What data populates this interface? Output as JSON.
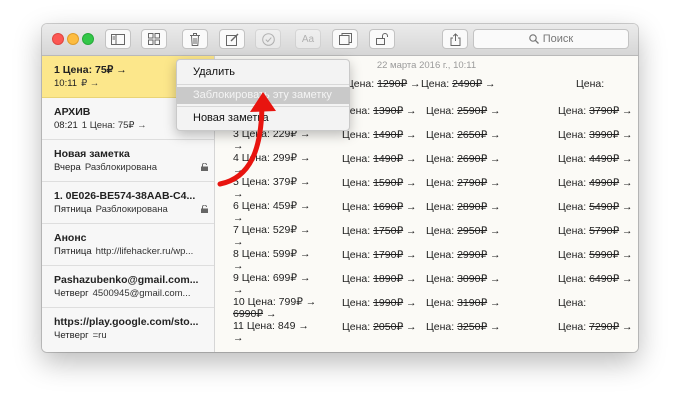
{
  "toolbar": {
    "buttons": [
      {
        "name": "sidebar-toggle-button",
        "icon": "sidebar-icon"
      },
      {
        "name": "attachments-browser-button",
        "icon": "grid-icon"
      },
      {
        "name": "delete-button",
        "icon": "trash-icon"
      },
      {
        "name": "new-note-button",
        "icon": "compose-icon"
      },
      {
        "name": "checklist-button",
        "icon": "checkmark-circle-icon"
      },
      {
        "name": "format-button",
        "icon": "text-format-icon"
      },
      {
        "name": "add-photo-button",
        "icon": "photo-icon"
      },
      {
        "name": "lock-button",
        "icon": "padlock-icon"
      },
      {
        "name": "share-button",
        "icon": "share-icon"
      }
    ],
    "format_label": "Aa",
    "search_placeholder": "Поиск"
  },
  "sidebar": {
    "notes": [
      {
        "title": "1 Цена: 75₽ →",
        "date": "10:11",
        "preview": "₽ →",
        "locked": false,
        "selected": true
      },
      {
        "title": "АРХИВ",
        "date": "08:21",
        "preview": "1 Цена: 75₽ →",
        "locked": false,
        "selected": false
      },
      {
        "title": "Новая заметка",
        "date": "Вчера",
        "preview": "Разблокирована",
        "locked": true,
        "selected": false
      },
      {
        "title": "1. 0E026-BE574-38AAB-C4...",
        "date": "Пятница",
        "preview": "Разблокирована",
        "locked": true,
        "selected": false
      },
      {
        "title": "Анонс",
        "date": "Пятница",
        "preview": "http://lifehacker.ru/wp...",
        "locked": false,
        "selected": false
      },
      {
        "title": "Pashazubenko@gmail.com...",
        "date": "Четверг",
        "preview": "4500945@gmail.com...",
        "locked": false,
        "selected": false
      },
      {
        "title": "https://play.google.com/sto...",
        "date": "Четверг",
        "preview": "=ru",
        "locked": false,
        "selected": false
      }
    ]
  },
  "content": {
    "date": "22 марта 2016 г., 10:11",
    "row0": {
      "c2": "Цена: ",
      "c2s": "1290₽",
      "c2a": " →",
      "c3": "Цена: ",
      "c3s": "2490₽",
      "c3a": " →",
      "c4": "Цена:"
    },
    "rows": [
      {
        "c1": "",
        "c1cont": "",
        "c2": "Цена: ",
        "c2s": "1390₽",
        "c3": "Цена: ",
        "c3s": "2590₽",
        "c4": "Цена: ",
        "c4s": "3790₽"
      },
      {
        "c1": "3 Цена: 229₽ →",
        "c2": "Цена: ",
        "c2s": "1490₽",
        "c3": "Цена: ",
        "c3s": "2650₽",
        "c4": "Цена: ",
        "c4s": "3990₽"
      },
      {
        "c1": "4 Цена: 299₽ →",
        "c2": "Цена: ",
        "c2s": "1490₽",
        "c3": "Цена: ",
        "c3s": "2690₽",
        "c4": "Цена: ",
        "c4s": "4490₽"
      },
      {
        "c1": "5 Цена: 379₽ →",
        "c2": "Цена: ",
        "c2s": "1590₽",
        "c3": "Цена: ",
        "c3s": "2790₽",
        "c4": "Цена: ",
        "c4s": "4990₽"
      },
      {
        "c1": "6 Цена: 459₽ →",
        "c2": "Цена: ",
        "c2s": "1690₽",
        "c3": "Цена: ",
        "c3s": "2890₽",
        "c4": "Цена: ",
        "c4s": "5490₽"
      },
      {
        "c1": "7 Цена: 529₽ →",
        "c2": "Цена: ",
        "c2s": "1750₽",
        "c3": "Цена: ",
        "c3s": "2950₽",
        "c4": "Цена: ",
        "c4s": "5790₽"
      },
      {
        "c1": "8 Цена: 599₽ →",
        "c2": "Цена: ",
        "c2s": "1790₽",
        "c3": "Цена: ",
        "c3s": "2990₽",
        "c4": "Цена: ",
        "c4s": "5990₽"
      },
      {
        "c1": "9 Цена: 699₽ →",
        "c2": "Цена: ",
        "c2s": "1890₽",
        "c3": "Цена: ",
        "c3s": "3090₽",
        "c4": "Цена: ",
        "c4s": "6490₽"
      },
      {
        "c1": "10 Цена: 799₽ →",
        "c2": "Цена: ",
        "c2s": "1990₽",
        "c3": "Цена: ",
        "c3s": "3190₽",
        "c4": "Цена:"
      },
      {
        "c1": "11 Цена: 849 →",
        "c2": "Цена: ",
        "c2s": "2050₽",
        "c3": "Цена: ",
        "c3s": "3250₽",
        "c4": "Цена: ",
        "c4s": "7290₽"
      }
    ],
    "arrow_glyph": "→",
    "wrap_6990": "6990₽ →"
  },
  "context_menu": {
    "items": [
      "Удалить",
      "Заблокировать эту заметку",
      "Новая заметка"
    ]
  },
  "colors": {
    "selected_note": "#fce78b",
    "annotation_arrow": "#e8140f",
    "menu_highlight": "#c9c9c9"
  }
}
